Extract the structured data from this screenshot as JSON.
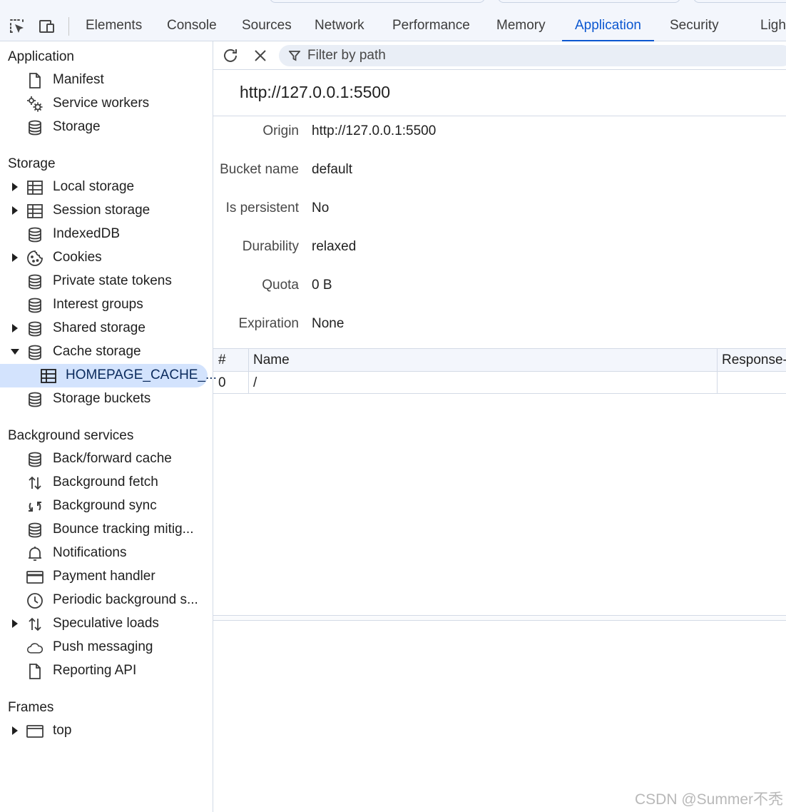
{
  "toolbar": {
    "tabs": [
      {
        "label": "Elements"
      },
      {
        "label": "Console"
      },
      {
        "label": "Sources"
      },
      {
        "label": "Network"
      },
      {
        "label": "Performance"
      },
      {
        "label": "Memory"
      },
      {
        "label": "Application",
        "active": true
      },
      {
        "label": "Security"
      },
      {
        "label": "Ligh"
      }
    ],
    "accent_color": "#0b57d0",
    "icons": [
      "inspect-element-icon",
      "device-toolbar-icon"
    ]
  },
  "sidebar": {
    "sections": {
      "application": {
        "title": "Application",
        "items": [
          {
            "label": "Manifest",
            "icon": "file-icon"
          },
          {
            "label": "Service workers",
            "icon": "gears-icon"
          },
          {
            "label": "Storage",
            "icon": "database-icon"
          }
        ]
      },
      "storage": {
        "title": "Storage",
        "items": [
          {
            "label": "Local storage",
            "icon": "table-icon",
            "expandable": true
          },
          {
            "label": "Session storage",
            "icon": "table-icon",
            "expandable": true
          },
          {
            "label": "IndexedDB",
            "icon": "database-icon"
          },
          {
            "label": "Cookies",
            "icon": "cookie-icon",
            "expandable": true
          },
          {
            "label": "Private state tokens",
            "icon": "database-icon"
          },
          {
            "label": "Interest groups",
            "icon": "database-icon"
          },
          {
            "label": "Shared storage",
            "icon": "database-icon",
            "expandable": true
          },
          {
            "label": "Cache storage",
            "icon": "database-icon",
            "expanded": true
          },
          {
            "label": "HOMEPAGE_CACHE_...",
            "icon": "table-icon",
            "selected": true
          },
          {
            "label": "Storage buckets",
            "icon": "database-icon"
          }
        ]
      },
      "background": {
        "title": "Background services",
        "items": [
          {
            "label": "Back/forward cache",
            "icon": "database-icon"
          },
          {
            "label": "Background fetch",
            "icon": "arrows-up-down-icon"
          },
          {
            "label": "Background sync",
            "icon": "sync-icon"
          },
          {
            "label": "Bounce tracking mitig...",
            "icon": "database-icon"
          },
          {
            "label": "Notifications",
            "icon": "bell-icon"
          },
          {
            "label": "Payment handler",
            "icon": "credit-card-icon"
          },
          {
            "label": "Periodic background s...",
            "icon": "clock-icon"
          },
          {
            "label": "Speculative loads",
            "icon": "arrows-up-down-icon",
            "expandable": true
          },
          {
            "label": "Push messaging",
            "icon": "cloud-icon"
          },
          {
            "label": "Reporting API",
            "icon": "file-icon"
          }
        ]
      },
      "frames": {
        "title": "Frames",
        "items": [
          {
            "label": "top",
            "icon": "window-icon",
            "expandable": true
          }
        ]
      }
    }
  },
  "main": {
    "filter_placeholder": "Filter by path",
    "origin_title": "http://127.0.0.1:5500",
    "info": [
      {
        "key": "Origin",
        "value": "http://127.0.0.1:5500"
      },
      {
        "key": "Bucket name",
        "value": "default"
      },
      {
        "key": "Is persistent",
        "value": "No"
      },
      {
        "key": "Durability",
        "value": "relaxed"
      },
      {
        "key": "Quota",
        "value": "0 B"
      },
      {
        "key": "Expiration",
        "value": "None"
      }
    ],
    "table": {
      "columns": [
        "#",
        "Name",
        "Response-"
      ],
      "rows": [
        {
          "num": "0",
          "name": "/",
          "response": ""
        }
      ]
    }
  },
  "watermark": "CSDN @Summer不秃"
}
